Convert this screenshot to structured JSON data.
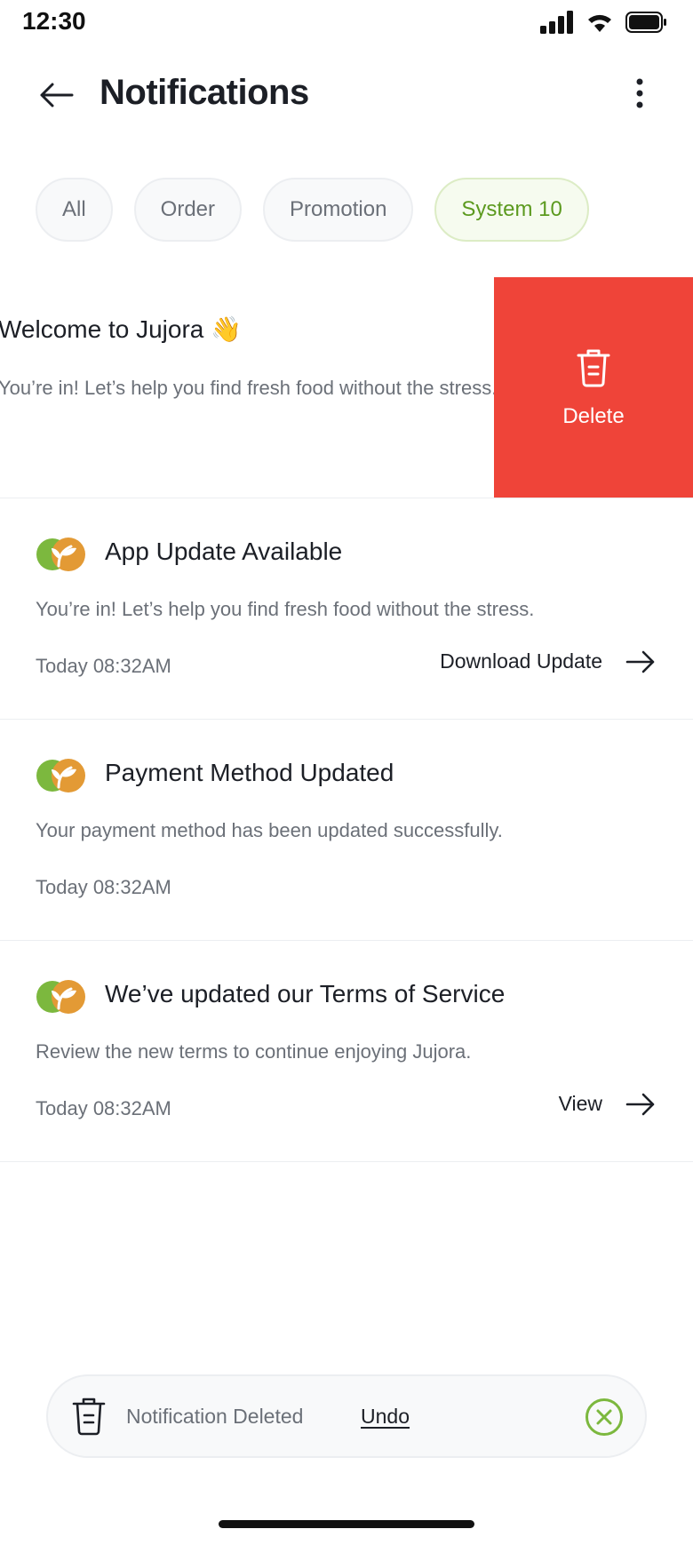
{
  "status_bar": {
    "time": "12:30"
  },
  "header": {
    "title": "Notifications"
  },
  "tabs": [
    {
      "label": "All",
      "active": false
    },
    {
      "label": "Order",
      "active": false
    },
    {
      "label": "Promotion",
      "active": false
    },
    {
      "label": "System 10",
      "active": true
    }
  ],
  "swiped": {
    "title": "Welcome to Jujora 👋",
    "body": "You’re in! Let’s help you find fresh food without the stress.",
    "delete_label": "Delete"
  },
  "notifications": [
    {
      "title": "App Update Available",
      "body": "You’re in! Let’s help you find fresh food without the stress.",
      "time": "Today 08:32AM",
      "action": "Download Update"
    },
    {
      "title": "Payment Method Updated",
      "body": "Your payment method has been updated successfully.",
      "time": "Today 08:32AM",
      "action": ""
    },
    {
      "title": "We’ve updated our Terms of Service",
      "body": "Review the new terms to continue enjoying Jujora.",
      "time": "Today 08:32AM",
      "action": "View"
    }
  ],
  "toast": {
    "message": "Notification Deleted",
    "undo_label": "Undo"
  },
  "colors": {
    "accent": "#5c9a1f",
    "danger": "#ef4439",
    "logo_green": "#7cb83e",
    "logo_orange": "#e39a35"
  },
  "icons": [
    "back-arrow-icon",
    "more-vertical-icon",
    "trash-icon",
    "arrow-right-icon",
    "close-circle-icon",
    "signal-icon",
    "wifi-icon",
    "battery-icon"
  ]
}
